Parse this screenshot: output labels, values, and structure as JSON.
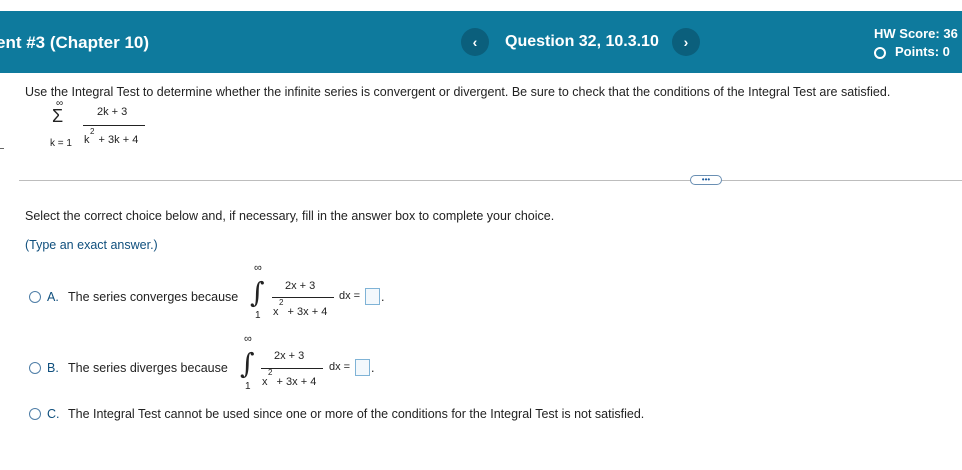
{
  "header": {
    "assignment_title": "ent #3 (Chapter 10)",
    "prev_glyph": "‹",
    "next_glyph": "›",
    "question_label": "Question 32, 10.3.10",
    "hw_score": "HW Score: 36",
    "points": "Points: 0"
  },
  "question": {
    "prompt": "Use the Integral Test to determine whether the infinite series is convergent or divergent. Be sure to check that the conditions of the Integral Test are satisfied.",
    "series": {
      "sigma": "Σ",
      "upper": "∞",
      "lower": "k = 1",
      "numerator": "2k + 3",
      "denominator_base": "k",
      "denominator_exp": "2",
      "denominator_rest": " + 3k + 4"
    }
  },
  "more_button": "•••",
  "instructions": "Select the correct choice below and, if necessary, fill in the answer box to complete your choice.",
  "hint": "(Type an exact answer.)",
  "integral": {
    "symbol": "∫",
    "upper": "∞",
    "lower": "1",
    "numerator": "2x + 3",
    "denominator_base": "x",
    "denominator_exp": "2",
    "denominator_rest": " + 3x + 4",
    "dx": "dx ="
  },
  "options": [
    {
      "letter": "A.",
      "text": "The series converges because",
      "period": "."
    },
    {
      "letter": "B.",
      "text": "The series diverges because",
      "period": "."
    },
    {
      "letter": "C.",
      "text": "The Integral Test cannot be used since one or more of the conditions for the Integral Test is not satisfied."
    }
  ]
}
